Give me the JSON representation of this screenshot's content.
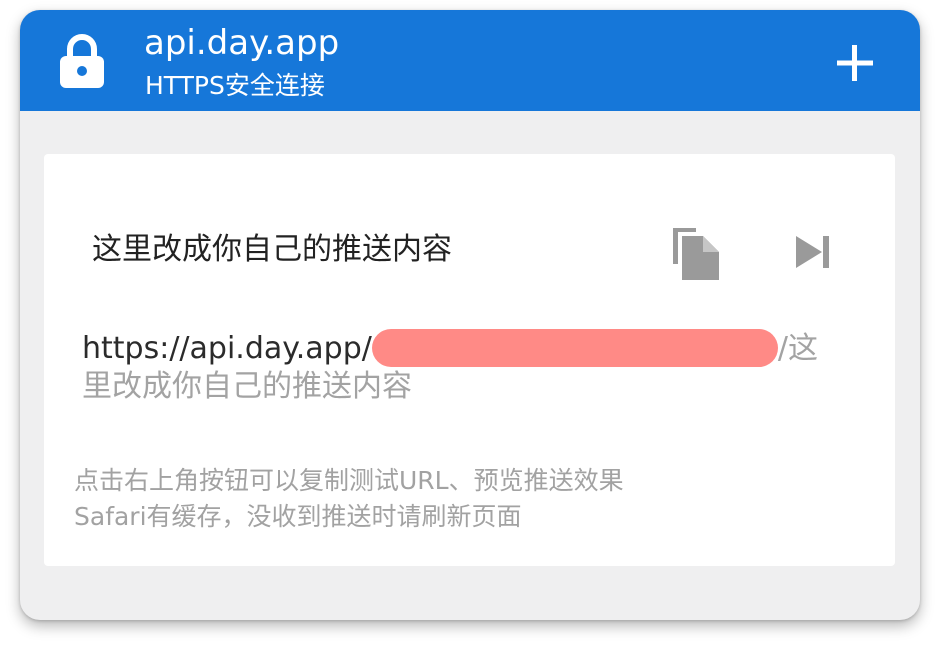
{
  "header": {
    "title": "api.day.app",
    "subtitle": "HTTPS安全连接",
    "lock_icon": "lock-icon",
    "add_icon": "plus-icon",
    "background_color": "#1677d9",
    "text_color": "#ffffff"
  },
  "card": {
    "message": "这里改成你自己的推送内容",
    "copy_icon": "copy-icon",
    "next_icon": "skip-next-icon",
    "url_prefix": "https://api.day.app/",
    "url_suffix": "/这里改成你自己的推送内容",
    "redaction_color": "#ff8a86",
    "hint_line1": "点击右上角按钮可以复制测试URL、预览推送效果",
    "hint_line2": "Safari有缓存，没收到推送时请刷新页面"
  }
}
